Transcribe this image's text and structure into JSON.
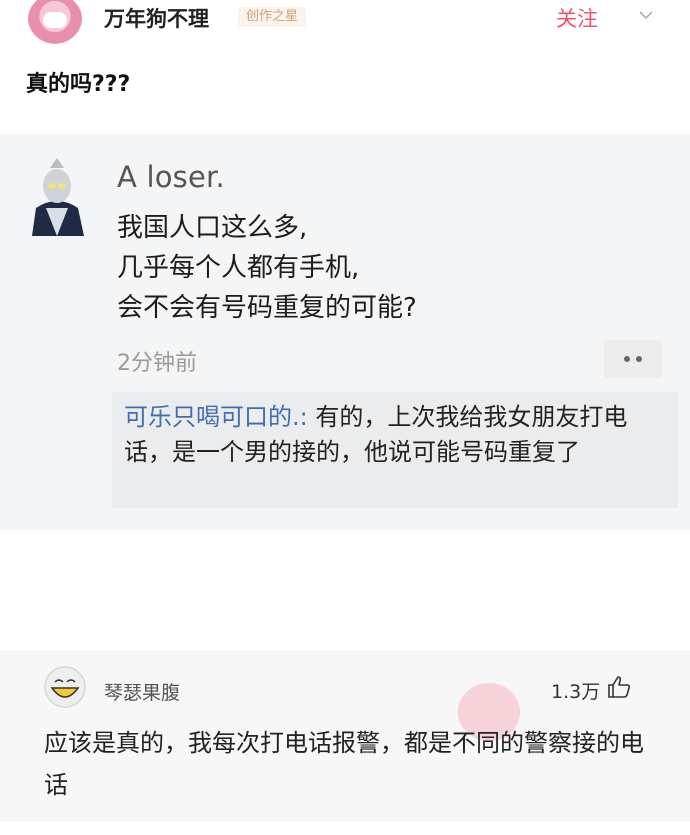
{
  "post": {
    "author": "万年狗不理",
    "badge": "创作之星",
    "follow_label": "关注",
    "text": "真的吗???"
  },
  "quote": {
    "author": "A loser.",
    "lines": [
      "我国人口这么多,",
      "几乎每个人都有手机,",
      "会不会有号码重复的可能?"
    ],
    "time": "2分钟前",
    "reply": {
      "name": "可乐只喝可口的.:",
      "text": " 有的，上次我给我女朋友打电话，是一个男的接的，他说可能号码重复了"
    }
  },
  "comment": {
    "author": "琴瑟果腹",
    "likes": "1.3万",
    "text": "应该是真的，我每次打电话报警，都是不同的警察接的电话"
  },
  "icons": {
    "more": "chevron-down-icon",
    "options": "more-dots-icon",
    "like": "thumb-up-icon"
  },
  "colors": {
    "follow": "#f2516b",
    "reply_name": "#3f6fb0",
    "quote_bg": "#f4f5f6"
  }
}
